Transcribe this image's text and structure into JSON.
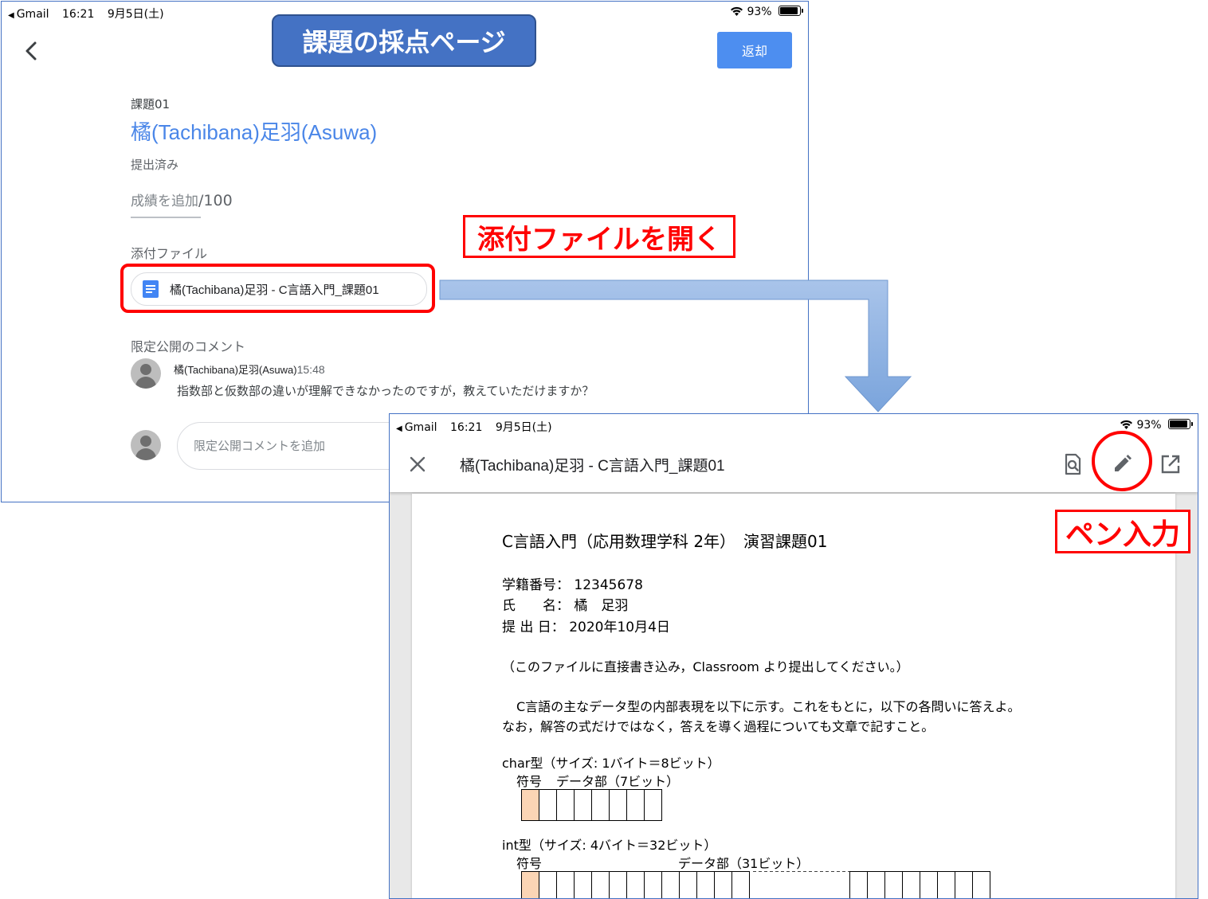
{
  "screen1": {
    "status_bar": {
      "app": "Gmail",
      "time": "16:21",
      "date": "9月5日(土)",
      "battery": "93%"
    },
    "callout_title": "課題の採点ページ",
    "return_button": "返却",
    "assignment_label": "課題01",
    "student_name": "橘(Tachibana)足羽(Asuwa)",
    "status": "提出済み",
    "grade_placeholder": "成績を追加",
    "grade_denominator": "/100",
    "attachments_heading": "添付ファイル",
    "attachment_name": "橘(Tachibana)足羽 - C言語入門_課題01",
    "private_comments_heading": "限定公開のコメント",
    "comment": {
      "author": "橘(Tachibana)足羽(Asuwa)",
      "time": "15:48",
      "text": "指数部と仮数部の違いが理解できなかったのですが，教えていただけますか？"
    },
    "comment_placeholder": "限定公開コメントを追加"
  },
  "annotations": {
    "open_attachment": "添付ファイルを開く",
    "pen_input": "ペン入力",
    "colors": {
      "callout": "#4472c4",
      "highlight": "#ff0000",
      "arrow": "#8eb4e3"
    }
  },
  "screen2": {
    "status_bar": {
      "app": "Gmail",
      "time": "16:21",
      "date": "9月5日(土)",
      "battery": "93%"
    },
    "doc_title": "橘(Tachibana)足羽 - C言語入門_課題01",
    "icons": [
      "close-icon",
      "find-in-page-icon",
      "pencil-icon",
      "open-external-icon"
    ],
    "document": {
      "heading": "C言語入門（応用数理学科 2年）　演習課題01",
      "student_id_label": "学籍番号：",
      "student_id": "12345678",
      "name_label": "氏　　名：",
      "name": "橘　足羽",
      "date_label": "提 出 日：",
      "date": "2020年10月4日",
      "note": "（このファイルに直接書き込み，Classroom より提出してください。）",
      "instruction_1": "C言語の主なデータ型の内部表現を以下に示す。これをもとに，以下の各問いに答えよ。",
      "instruction_2": "なお，解答の式だけではなく，答えを導く過程についても文章で記すこと。",
      "char_type": "char型（サイズ: 1バイト＝8ビット）",
      "char_sign": "符号",
      "char_data": "データ部（7ビット）",
      "int_type": "int型（サイズ: 4バイト＝32ビット）",
      "int_sign": "符号",
      "int_data": "データ部（31ビット）"
    }
  }
}
